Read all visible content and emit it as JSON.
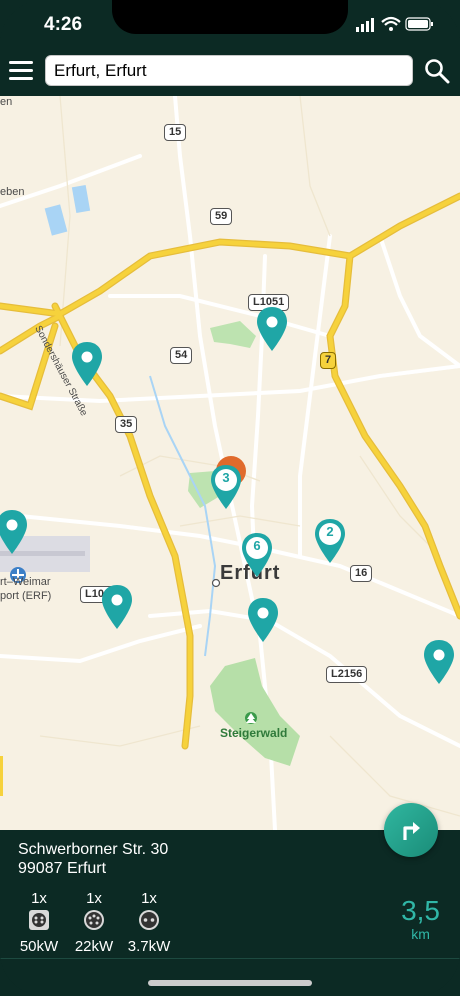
{
  "status_bar": {
    "time": "4:26"
  },
  "search": {
    "value": "Erfurt, Erfurt"
  },
  "map": {
    "city_label": "Erfurt",
    "park_label": "Steigerwald",
    "street_label": "Sondershäuser Straße",
    "edge_label_top": "en",
    "edge_label_left": "eben",
    "airport_label_1": "rt–Weimar",
    "airport_label_2": "port (ERF)",
    "road_badges": [
      "15",
      "59",
      "L1051",
      "54",
      "7",
      "35",
      "16",
      "L104",
      "L2156"
    ],
    "cluster_counts": [
      "3",
      "6",
      "2"
    ]
  },
  "station": {
    "street": "Schwerborner Str. 30",
    "city": "99087 Erfurt",
    "connectors": [
      {
        "count": "1x",
        "power": "50kW",
        "icon": "ccs-plug-icon"
      },
      {
        "count": "1x",
        "power": "22kW",
        "icon": "type2-plug-icon"
      },
      {
        "count": "1x",
        "power": "3.7kW",
        "icon": "schuko-plug-icon"
      }
    ],
    "distance_value": "3,5",
    "distance_unit": "km"
  },
  "colors": {
    "accent": "#1fa6a6",
    "background": "#0c2a24",
    "map_bg": "#f7f1e3",
    "motorway": "#f6d23c"
  }
}
